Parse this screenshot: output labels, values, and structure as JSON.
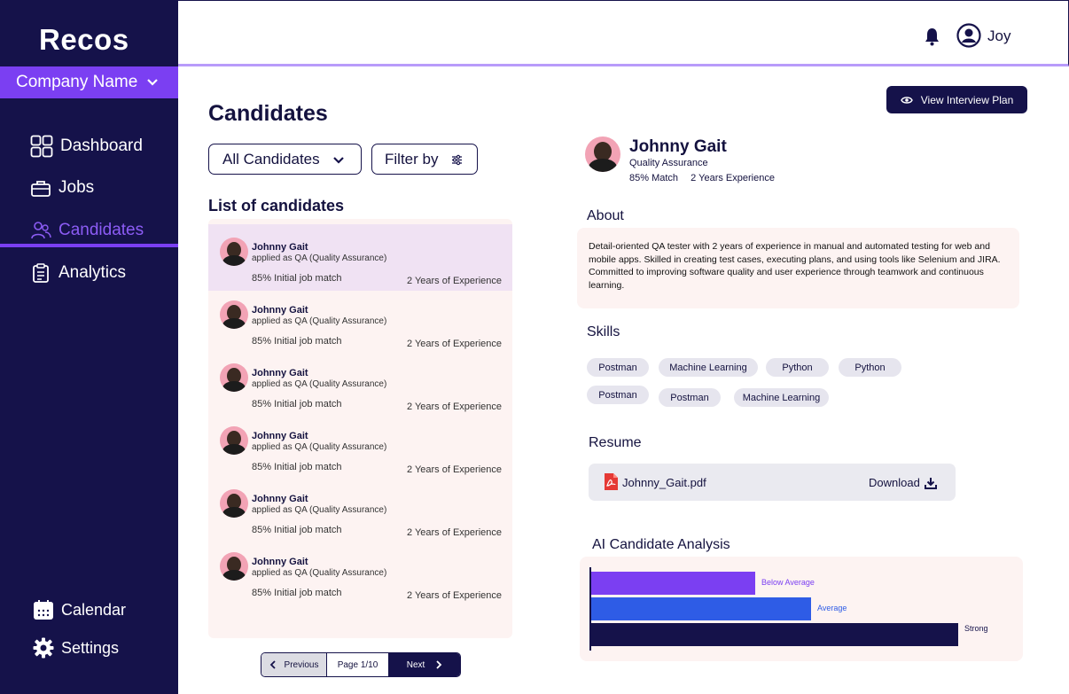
{
  "app": {
    "logo": "Recos",
    "company": "Company Name"
  },
  "nav": {
    "dashboard": "Dashboard",
    "jobs": "Jobs",
    "candidates": "Candidates",
    "analytics": "Analytics",
    "calendar": "Calendar",
    "settings": "Settings"
  },
  "header": {
    "user": "Joy"
  },
  "page": {
    "title": "Candidates",
    "list_heading": "List of candidates"
  },
  "controls": {
    "dropdown": "All Candidates",
    "filter": "Filter by",
    "view_plan": "View Interview Plan"
  },
  "candidates": [
    {
      "name": "Johnny Gait",
      "applied": "applied as QA (Quality Assurance)",
      "match": "85% Initial job match",
      "experience": "2 Years of Experience"
    },
    {
      "name": "Johnny Gait",
      "applied": "applied as QA (Quality Assurance)",
      "match": "85% Initial job match",
      "experience": "2 Years of Experience"
    },
    {
      "name": "Johnny Gait",
      "applied": "applied as QA (Quality Assurance)",
      "match": "85% Initial job match",
      "experience": "2 Years of Experience"
    },
    {
      "name": "Johnny Gait",
      "applied": "applied as QA (Quality Assurance)",
      "match": "85% Initial job match",
      "experience": "2 Years of Experience"
    },
    {
      "name": "Johnny Gait",
      "applied": "applied as QA (Quality Assurance)",
      "match": "85% Initial job match",
      "experience": "2 Years of Experience"
    },
    {
      "name": "Johnny Gait",
      "applied": "applied as QA (Quality Assurance)",
      "match": "85% Initial job match",
      "experience": "2 Years of Experience"
    }
  ],
  "pagination": {
    "prev": "Previous",
    "page": "Page 1/10",
    "next": "Next"
  },
  "detail": {
    "name": "Johnny Gait",
    "role": "Quality Assurance",
    "match": "85% Match",
    "experience": "2 Years Experience",
    "about_title": "About",
    "about_text": "Detail-oriented QA tester with 2 years of experience in manual and  automated testing for web and mobile apps. Skilled in creating test  cases, executing plans, and using tools like Selenium and JIRA.  Committed to improving software quality and user experience through  teamwork and continuous learning.",
    "skills_title": "Skills",
    "skills": [
      "Postman",
      "Machine Learning",
      "Python",
      "Python",
      "Postman",
      "Postman",
      "Machine Learning"
    ],
    "resume_title": "Resume",
    "resume_file": "Johnny_Gait.pdf",
    "download": "Download",
    "analysis_title": "AI Candidate Analysis"
  },
  "chart_data": {
    "type": "bar",
    "categories": [
      "Below Average",
      "Average",
      "Strong"
    ],
    "values": [
      185,
      248,
      414
    ],
    "colors": [
      "#7b3ff2",
      "#2e5ce6",
      "#15124a"
    ]
  },
  "colors": {
    "sidebar": "#15124a",
    "accent": "#7b3ff2",
    "panel": "#fdf3f2"
  }
}
